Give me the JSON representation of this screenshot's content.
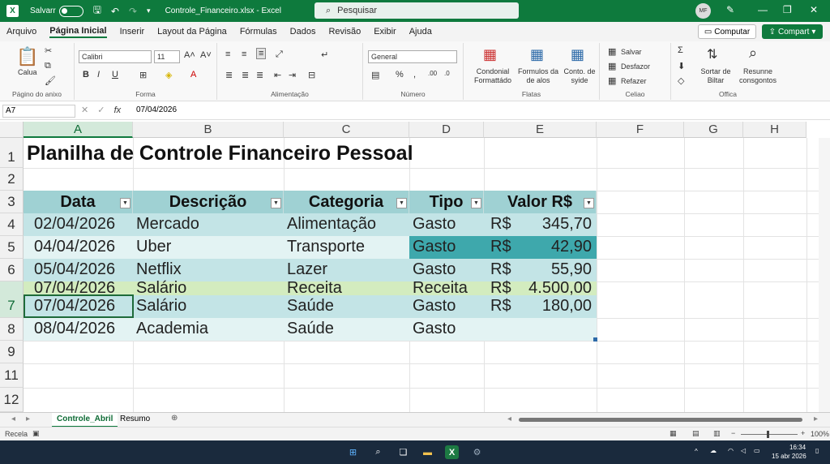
{
  "titlebar": {
    "autosave_label": "Salvarr",
    "filename": "Controle_Financeiro.xlsx  -  Excel",
    "search_placeholder": "Pesquisar",
    "avatar_initials": "MF"
  },
  "menu": {
    "tabs": [
      "Arquivo",
      "Página Inicial",
      "Inserir",
      "Layout da Página",
      "Fórmulas",
      "Dados",
      "Revisão",
      "Exibir",
      "Ajuda"
    ],
    "computar_label": "Computar",
    "compart_label": "Compart"
  },
  "ribbon": {
    "paste_label": "Calua",
    "clipboard_group": "Págino do anixo",
    "font_name": "Calibri",
    "font_size": "11",
    "font_group": "Forma",
    "align_group": "Alimentação",
    "number_format": "General",
    "number_group": "Número",
    "cond_format_label": "Condonial Formattádo",
    "format_table_label": "Formulos da de alos",
    "cell_styles_label": "Conto. de syide",
    "styles_group": "Flatas",
    "insert_label": "Salvar",
    "delete_label": "Desfazor",
    "format_label": "Refazer",
    "cells_group": "Celiao",
    "sort_label": "Sortar de Biltar",
    "find_label": "Resunne consgontos",
    "editing_group": "Offica"
  },
  "formula_bar": {
    "name_box": "A7",
    "fx": "fx",
    "value": "07/04/2026"
  },
  "columns": [
    "A",
    "B",
    "C",
    "D",
    "E",
    "F",
    "G",
    "H"
  ],
  "rows": [
    "1",
    "2",
    "3",
    "4",
    "5",
    "6",
    "7",
    "8",
    "9",
    "11",
    "12"
  ],
  "sheet": {
    "title": "Planilha de Controle Financeiro Pessoal",
    "headers": [
      "Data",
      "Descrição",
      "Categoria",
      "Tipo",
      "Valor R$"
    ],
    "records": [
      {
        "date": "02/04/2026",
        "desc": "Mercado",
        "cat": "Alimentação",
        "type": "Gasto",
        "cur": "R$",
        "amount": "345,70"
      },
      {
        "date": "04/04/2026",
        "desc": "Uber",
        "cat": "Transporte",
        "type": "Gasto",
        "cur": "R$",
        "amount": "42,90"
      },
      {
        "date": "05/04/2026",
        "desc": "Netflix",
        "cat": "Lazer",
        "type": "Gasto",
        "cur": "R$",
        "amount": "55,90"
      },
      {
        "date": "07/04/2026",
        "desc": "Salário",
        "cat": "Receita",
        "type": "Receita",
        "cur": "R$",
        "amount": "4.500,00"
      },
      {
        "date": "07/04/2026",
        "desc": "Salário",
        "cat": "Saúde",
        "type": "Gasto",
        "cur": "R$",
        "amount": "180,00"
      },
      {
        "date": "08/04/2026",
        "desc": "Academia",
        "cat": "Saúde",
        "type": "Gasto",
        "cur": "",
        "amount": ""
      }
    ]
  },
  "sheet_tabs": [
    "Controle_Abril",
    "Resumo"
  ],
  "status": {
    "mode": "Recela",
    "zoom": "100%"
  },
  "taskbar": {
    "time": "16:34",
    "date": "15 abr 2026"
  },
  "colors": {
    "brand": "#0e7a3d",
    "table_header": "#9fd1d3",
    "band_light": "#e3f3f3",
    "band_mid": "#c3e4e6",
    "income_row": "#d3ecbf",
    "highlight": "#3ea8ac"
  }
}
